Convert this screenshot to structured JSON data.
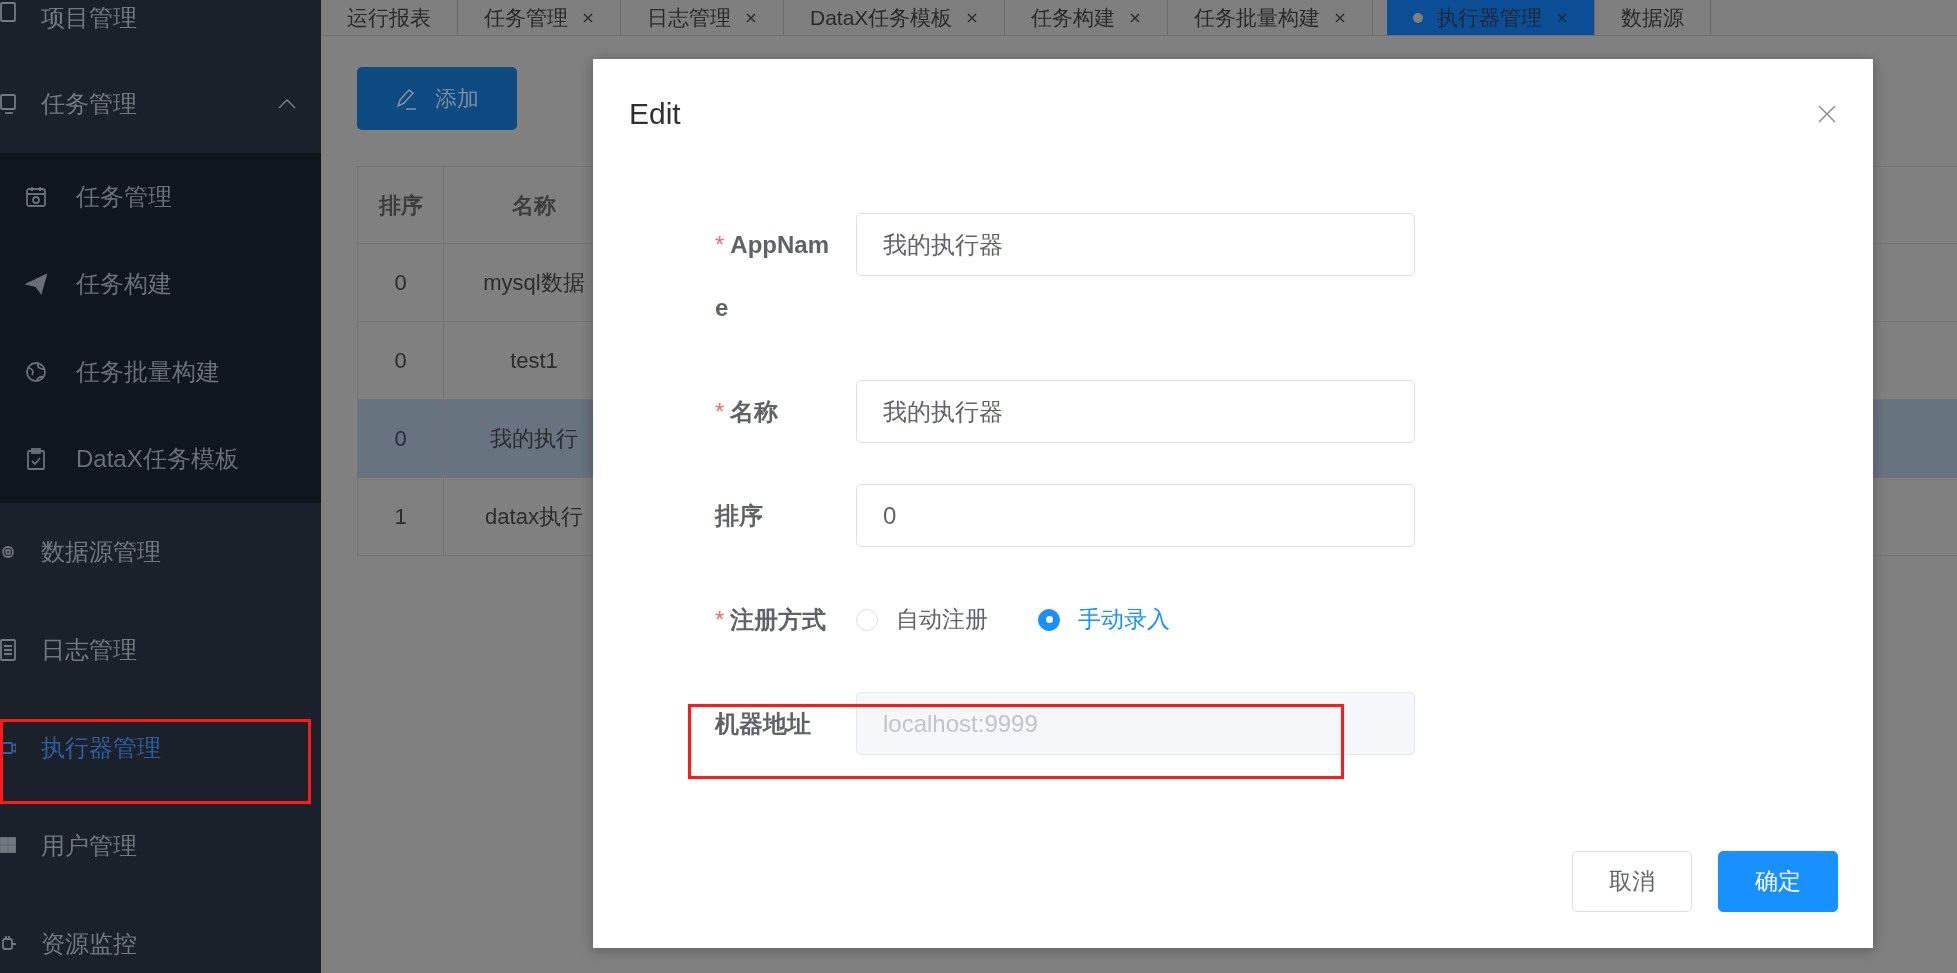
{
  "sidebar": {
    "items": [
      {
        "label": "项目管理",
        "selected": false
      },
      {
        "label": "任务管理",
        "selected": false,
        "expanded": true,
        "children": [
          {
            "label": "任务管理",
            "selected": false
          },
          {
            "label": "任务构建",
            "selected": false
          },
          {
            "label": "任务批量构建",
            "selected": false
          },
          {
            "label": "DataX任务模板",
            "selected": false
          }
        ]
      },
      {
        "label": "数据源管理",
        "selected": false
      },
      {
        "label": "日志管理",
        "selected": false
      },
      {
        "label": "执行器管理",
        "selected": true,
        "annotated": true
      },
      {
        "label": "用户管理",
        "selected": false
      },
      {
        "label": "资源监控",
        "selected": false
      }
    ]
  },
  "tabs": [
    {
      "label": "运行报表",
      "closable": false,
      "selected": false
    },
    {
      "label": "任务管理",
      "closable": true,
      "selected": false
    },
    {
      "label": "日志管理",
      "closable": true,
      "selected": false
    },
    {
      "label": "DataX任务模板",
      "closable": true,
      "selected": false
    },
    {
      "label": "任务构建",
      "closable": true,
      "selected": false
    },
    {
      "label": "任务批量构建",
      "closable": true,
      "selected": false
    },
    {
      "label": "执行器管理",
      "closable": true,
      "selected": true
    },
    {
      "label": "数据源",
      "closable": false,
      "selected": false
    }
  ],
  "add_button": {
    "label": "添加"
  },
  "table": {
    "columns": [
      "排序",
      "名称"
    ],
    "rows": [
      {
        "cells": [
          "0",
          "mysql数据"
        ],
        "highlighted": false
      },
      {
        "cells": [
          "0",
          "test1"
        ],
        "highlighted": false
      },
      {
        "cells": [
          "0",
          "我的执行"
        ],
        "highlighted": true
      },
      {
        "cells": [
          "1",
          "datax执行"
        ],
        "highlighted": false
      }
    ]
  },
  "dialog": {
    "title": "Edit",
    "required_mark": "*",
    "fields": [
      {
        "kind": "input",
        "label": "AppName",
        "required": true,
        "value": "我的执行器"
      },
      {
        "kind": "input",
        "label": "名称",
        "required": true,
        "value": "我的执行器"
      },
      {
        "kind": "input",
        "label": "排序",
        "required": false,
        "value": "0"
      },
      {
        "kind": "radio",
        "label": "注册方式",
        "required": true,
        "options": [
          {
            "label": "自动注册",
            "selected": false
          },
          {
            "label": "手动录入",
            "selected": true
          }
        ]
      },
      {
        "kind": "input",
        "label": "机器地址",
        "required": false,
        "placeholder": "localhost:9999",
        "disabled": true,
        "annotated": true
      }
    ],
    "buttons": [
      {
        "label": "取消",
        "kind": "default"
      },
      {
        "label": "确定",
        "kind": "primary"
      }
    ]
  }
}
